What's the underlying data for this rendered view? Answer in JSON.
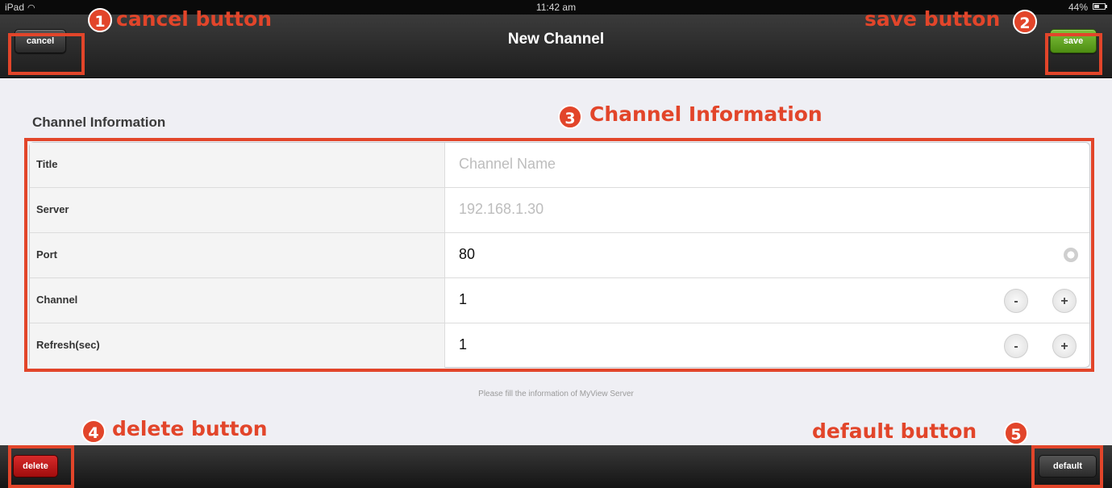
{
  "status_bar": {
    "carrier": "iPad",
    "time": "11:42 am",
    "battery": "44%"
  },
  "nav": {
    "title": "New Channel",
    "cancel_label": "cancel",
    "save_label": "save"
  },
  "form": {
    "section_title": "Channel Information",
    "rows": [
      {
        "label": "Title",
        "placeholder": "Channel Name"
      },
      {
        "label": "Server",
        "placeholder": "192.168.1.30"
      },
      {
        "label": "Port",
        "value": "80"
      },
      {
        "label": "Channel",
        "value": "1",
        "minus": "-",
        "plus": "+"
      },
      {
        "label": "Refresh(sec)",
        "value": "1",
        "minus": "-",
        "plus": "+"
      }
    ],
    "help_text": "Please fill the information of MyView Server"
  },
  "toolbar": {
    "delete_label": "delete",
    "default_label": "default"
  },
  "annotations": [
    {
      "number": "1",
      "label": "cancel button"
    },
    {
      "number": "2",
      "label": "save button"
    },
    {
      "number": "3",
      "label": "Channel Information"
    },
    {
      "number": "4",
      "label": "delete button"
    },
    {
      "number": "5",
      "label": "default button"
    }
  ],
  "colors": {
    "annotation": "#e2452a",
    "save_green": "#5da01f",
    "delete_red": "#c41a1a",
    "nav_dark": "#2a2a2a"
  }
}
